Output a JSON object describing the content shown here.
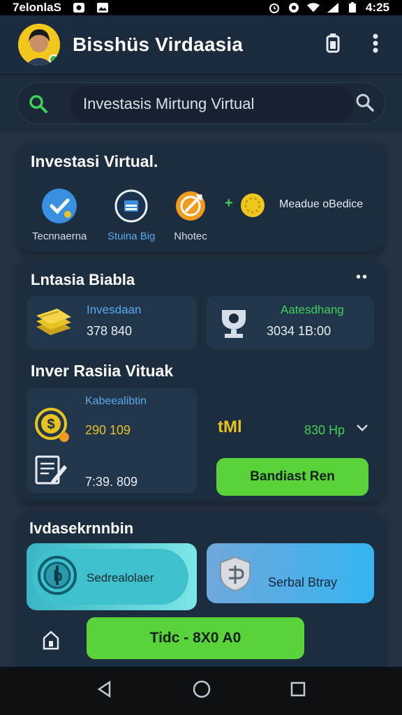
{
  "status_bar": {
    "carrier": "7elonlaS",
    "time": "4:25"
  },
  "app_bar": {
    "title": "Bisshüs Virdaasia",
    "icons": [
      "avatar",
      "battery-icon",
      "more-vert-icon"
    ]
  },
  "search": {
    "value": "Investasis Mirtung Virtual"
  },
  "card_investasi": {
    "title": "Investasi Virtual.",
    "items": [
      {
        "label": "Tecnnaerna",
        "icon": "check-badge-icon"
      },
      {
        "label": "Stuina Big",
        "icon": "bank-icon"
      },
      {
        "label": "Nhotec",
        "icon": "target-icon"
      }
    ],
    "coin_text": "Meadue oBedice",
    "plus_sign": "+"
  },
  "card_lntasia": {
    "title": "Lntasia Biabla",
    "dots": "••",
    "mini_left": {
      "label": "Invesdaan",
      "value": "378 840"
    },
    "mini_right": {
      "label": "Aatesdhang",
      "value": "3034 1B:00"
    },
    "section_title": "Inver Rasiia Vituak",
    "finance": {
      "label": "Kabeealibtin",
      "value": "290 109",
      "value2": "7:39. 809"
    },
    "tm_text": "tMl",
    "amount": "830 Hp",
    "button": "Bandiast Ren"
  },
  "card_bottom": {
    "title": "lvdasekrnnbin",
    "tile_left": "Sedrealolaer",
    "tile_right": "Serbal Btray",
    "button": "Tidc - 8X0 A0"
  },
  "colors": {
    "accent_green": "#5ad33b",
    "accent_blue": "#3a8fe0",
    "background": "#243243",
    "card": "#1c2d40"
  }
}
